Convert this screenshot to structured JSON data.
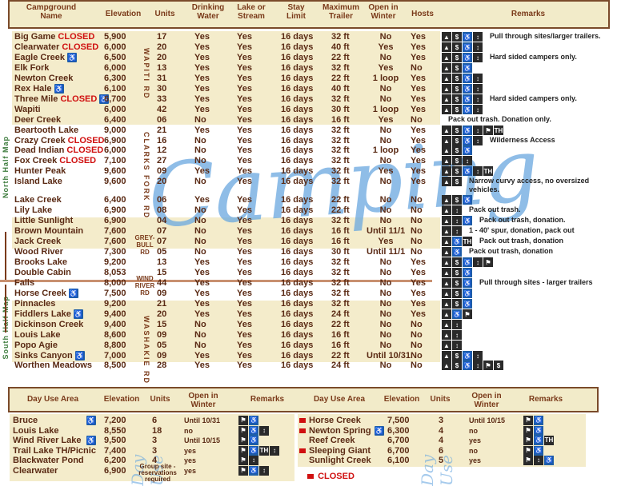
{
  "headers": {
    "name": "Campground Name",
    "elevation": "Elevation",
    "units": "Units",
    "water": "Drinking Water",
    "lake": "Lake or Stream",
    "stay": "Stay Limit",
    "trailer": "Maximum Trailer",
    "winter": "Open in Winter",
    "hosts": "Hosts",
    "remarks": "Remarks"
  },
  "watermark": "Camping",
  "side_labels": {
    "north": "North Half Map",
    "south": "South Half Map",
    "wapiti": "WAPITI RD",
    "clarks": "CLARKS FORK RD",
    "greybull": "GREY-BULL RD",
    "windriver": "WIND RIVER RD",
    "washakie": "WASHAKIE RD"
  },
  "closed_word": "CLOSED",
  "campgrounds": [
    {
      "name": "Big Game",
      "closed": "CLOSED",
      "hc": "",
      "elev": "5,900",
      "units": "17",
      "water": "Yes",
      "lake": "Yes",
      "stay": "16 days",
      "trailer": "32 ft",
      "winter": "No",
      "hosts": "Yes",
      "remark": "Pull through sites/larger trailers.",
      "icons": [
        "▲",
        "$",
        "♿",
        "↕"
      ]
    },
    {
      "name": "Clearwater",
      "closed": "CLOSED",
      "hc": "",
      "elev": "6,000",
      "units": "20",
      "water": "Yes",
      "lake": "Yes",
      "stay": "16 days",
      "trailer": "40 ft",
      "winter": "Yes",
      "hosts": "Yes",
      "remark": "",
      "icons": [
        "▲",
        "$",
        "♿",
        "↕"
      ]
    },
    {
      "name": "Eagle Creek",
      "closed": "",
      "hc": "♿",
      "elev": "6,500",
      "units": "20",
      "water": "Yes",
      "lake": "Yes",
      "stay": "16 days",
      "trailer": "22 ft",
      "winter": "No",
      "hosts": "Yes",
      "remark": "Hard sided campers only.",
      "icons": [
        "▲",
        "$",
        "♿",
        "↕"
      ]
    },
    {
      "name": "Elk Fork",
      "closed": "",
      "hc": "",
      "elev": "6,000",
      "units": "13",
      "water": "Yes",
      "lake": "Yes",
      "stay": "16 days",
      "trailer": "32 ft",
      "winter": "Yes",
      "hosts": "No",
      "remark": "",
      "icons": [
        "▲",
        "$",
        "♿"
      ]
    },
    {
      "name": "Newton Creek",
      "closed": "",
      "hc": "",
      "elev": "6,300",
      "units": "31",
      "water": "Yes",
      "lake": "Yes",
      "stay": "16 days",
      "trailer": "22 ft",
      "winter": "1 loop",
      "hosts": "Yes",
      "remark": "",
      "icons": [
        "▲",
        "$",
        "♿",
        "↕"
      ]
    },
    {
      "name": "Rex Hale",
      "closed": "",
      "hc": "♿",
      "elev": "6,100",
      "units": "30",
      "water": "Yes",
      "lake": "Yes",
      "stay": "16 days",
      "trailer": "40 ft",
      "winter": "No",
      "hosts": "Yes",
      "remark": "",
      "icons": [
        "▲",
        "$",
        "♿",
        "↕"
      ]
    },
    {
      "name": "Three Mile",
      "closed": "CLOSED",
      "hc": "♿",
      "elev": "6,700",
      "units": "33",
      "water": "Yes",
      "lake": "Yes",
      "stay": "16 days",
      "trailer": "32 ft",
      "winter": "No",
      "hosts": "Yes",
      "remark": "Hard sided campers only.",
      "icons": [
        "▲",
        "$",
        "♿",
        "↕"
      ]
    },
    {
      "name": "Wapiti",
      "closed": "",
      "hc": "",
      "elev": "6,000",
      "units": "42",
      "water": "Yes",
      "lake": "Yes",
      "stay": "16 days",
      "trailer": "30 ft",
      "winter": "1 loop",
      "hosts": "Yes",
      "remark": "",
      "icons": [
        "▲",
        "$",
        "♿",
        "↕"
      ]
    },
    {
      "name": "Deer Creek",
      "closed": "",
      "hc": "",
      "elev": "6,400",
      "units": "06",
      "water": "No",
      "lake": "Yes",
      "stay": "16 days",
      "trailer": "16 ft",
      "winter": "Yes",
      "hosts": "No",
      "remark": "Pack out trash.  Donation only.",
      "icons": []
    },
    {
      "name": "Beartooth Lake",
      "closed": "",
      "hc": "",
      "elev": "9,000",
      "units": "21",
      "water": "Yes",
      "lake": "Yes",
      "stay": "16 days",
      "trailer": "32 ft",
      "winter": "No",
      "hosts": "Yes",
      "remark": "",
      "icons": [
        "▲",
        "$",
        "♿",
        "↕",
        "⚑",
        "TH"
      ]
    },
    {
      "name": "Crazy Creek",
      "closed": "CLOSED",
      "hc": "",
      "elev": "6,900",
      "units": "16",
      "water": "No",
      "lake": "Yes",
      "stay": "16 days",
      "trailer": "32 ft",
      "winter": "No",
      "hosts": "Yes",
      "remark": "Wilderness Access",
      "icons": [
        "▲",
        "$",
        "♿",
        "↕"
      ]
    },
    {
      "name": "Dead Indian",
      "closed": "CLOSED",
      "hc": "",
      "elev": "6,000",
      "units": "12",
      "water": "No",
      "lake": "Yes",
      "stay": "16 days",
      "trailer": "32 ft",
      "winter": "1 loop",
      "hosts": "Yes",
      "remark": "",
      "icons": [
        "▲",
        "$",
        "♿"
      ]
    },
    {
      "name": "Fox Creek",
      "closed": "CLOSED",
      "hc": "",
      "elev": "7,100",
      "units": "27",
      "water": "No",
      "lake": "Yes",
      "stay": "16 days",
      "trailer": "32 ft",
      "winter": "No",
      "hosts": "Yes",
      "remark": "",
      "icons": [
        "▲",
        "$",
        "↕"
      ]
    },
    {
      "name": "Hunter Peak",
      "closed": "",
      "hc": "",
      "elev": "9,600",
      "units": "09",
      "water": "Yes",
      "lake": "Yes",
      "stay": "16 days",
      "trailer": "32 ft",
      "winter": "Yes",
      "hosts": "Yes",
      "remark": "",
      "icons": [
        "▲",
        "$",
        "♿",
        "↕",
        "TH"
      ]
    },
    {
      "name": "Island Lake",
      "closed": "",
      "hc": "",
      "elev": "9,600",
      "units": "20",
      "water": "No",
      "lake": "Yes",
      "stay": "16 days",
      "trailer": "32 ft",
      "winter": "No",
      "hosts": "Yes",
      "remark": "Narrow curvy access, no oversized  vehicles.",
      "icons": [
        "▲",
        "$"
      ]
    },
    {
      "name": "Lake Creek",
      "closed": "",
      "hc": "",
      "elev": "6,400",
      "units": "06",
      "water": "Yes",
      "lake": "Yes",
      "stay": "16 days",
      "trailer": "22 ft",
      "winter": "No",
      "hosts": "No",
      "remark": "",
      "icons": [
        "▲",
        "$",
        "♿"
      ]
    },
    {
      "name": "Lily Lake",
      "closed": "",
      "hc": "",
      "elev": "6,900",
      "units": "08",
      "water": "No",
      "lake": "Yes",
      "stay": "16 days",
      "trailer": "22 ft",
      "winter": "No",
      "hosts": "No",
      "remark": "Pack out trash.",
      "icons": [
        "▲",
        "↕"
      ]
    },
    {
      "name": "Little Sunlight",
      "closed": "",
      "hc": "",
      "elev": "6,900",
      "units": "04",
      "water": "No",
      "lake": "Yes",
      "stay": "16 days",
      "trailer": "32 ft",
      "winter": "No",
      "hosts": "No",
      "remark": "Pack out trash, donation.",
      "icons": [
        "▲",
        "↕",
        "♿"
      ]
    },
    {
      "name": "Brown Mountain",
      "closed": "",
      "hc": "",
      "elev": "7,600",
      "units": "07",
      "water": "No",
      "lake": "Yes",
      "stay": "16 days",
      "trailer": "16 ft",
      "winter": "Until 11/1",
      "hosts": "No",
      "remark": "1 - 40' spur, donation, pack out",
      "icons": [
        "▲",
        "↕"
      ]
    },
    {
      "name": "Jack Creek",
      "closed": "",
      "hc": "",
      "elev": "7,600",
      "units": "07",
      "water": "No",
      "lake": "Yes",
      "stay": "16 days",
      "trailer": "16 ft",
      "winter": "Yes",
      "hosts": "No",
      "remark": "Pack out trash, donation",
      "icons": [
        "▲",
        "♿",
        "TH"
      ]
    },
    {
      "name": "Wood River",
      "closed": "",
      "hc": "",
      "elev": "7,300",
      "units": "05",
      "water": "No",
      "lake": "Yes",
      "stay": "16 days",
      "trailer": "30 ft",
      "winter": "Until 11/1",
      "hosts": "No",
      "remark": "Pack out trash, donation",
      "icons": [
        "▲",
        "♿"
      ]
    },
    {
      "name": "Brooks Lake",
      "closed": "",
      "hc": "",
      "elev": "9,200",
      "units": "13",
      "water": "Yes",
      "lake": "Yes",
      "stay": "16 days",
      "trailer": "32 ft",
      "winter": "No",
      "hosts": "Yes",
      "remark": "",
      "icons": [
        "▲",
        "$",
        "♿",
        "↕",
        "⚑"
      ]
    },
    {
      "name": "Double Cabin",
      "closed": "",
      "hc": "",
      "elev": "8,053",
      "units": "15",
      "water": "Yes",
      "lake": "Yes",
      "stay": "16 days",
      "trailer": "32 ft",
      "winter": "No",
      "hosts": "Yes",
      "remark": "",
      "icons": [
        "▲",
        "$",
        "♿"
      ]
    },
    {
      "name": "Falls",
      "closed": "",
      "hc": "",
      "elev": "8,000",
      "units": "44",
      "water": "Yes",
      "lake": "Yes",
      "stay": "16 days",
      "trailer": "32 ft",
      "winter": "No",
      "hosts": "Yes",
      "remark": "Pull through sites - larger trailers",
      "icons": [
        "▲",
        "$",
        "♿"
      ]
    },
    {
      "name": "Horse Creek",
      "closed": "",
      "hc": "♿",
      "elev": "7,500",
      "units": "09",
      "water": "Yes",
      "lake": "Yes",
      "stay": "16 days",
      "trailer": "32 ft",
      "winter": "No",
      "hosts": "Yes",
      "remark": "",
      "icons": [
        "▲",
        "$",
        "♿"
      ]
    },
    {
      "name": "Pinnacles",
      "closed": "",
      "hc": "",
      "elev": "9,200",
      "units": "21",
      "water": "Yes",
      "lake": "Yes",
      "stay": "16 days",
      "trailer": "32 ft",
      "winter": "No",
      "hosts": "Yes",
      "remark": "",
      "icons": [
        "▲",
        "$",
        "♿"
      ]
    },
    {
      "name": "Fiddlers Lake",
      "closed": "",
      "hc": "♿",
      "elev": "9,400",
      "units": "20",
      "water": "Yes",
      "lake": "Yes",
      "stay": "16 days",
      "trailer": "24 ft",
      "winter": "No",
      "hosts": "Yes",
      "remark": "",
      "icons": [
        "▲",
        "♿",
        "⚑"
      ]
    },
    {
      "name": "Dickinson Creek",
      "closed": "",
      "hc": "",
      "elev": "9,400",
      "units": "15",
      "water": "No",
      "lake": "Yes",
      "stay": "16 days",
      "trailer": "22 ft",
      "winter": "No",
      "hosts": "No",
      "remark": "",
      "icons": [
        "▲",
        "↕"
      ]
    },
    {
      "name": "Louis Lake",
      "closed": "",
      "hc": "",
      "elev": "8,600",
      "units": "09",
      "water": "No",
      "lake": "Yes",
      "stay": "16 days",
      "trailer": "16 ft",
      "winter": "No",
      "hosts": "No",
      "remark": "",
      "icons": [
        "▲",
        "↕"
      ]
    },
    {
      "name": "Popo Agie",
      "closed": "",
      "hc": "",
      "elev": "8,800",
      "units": "05",
      "water": "No",
      "lake": "Yes",
      "stay": "16 days",
      "trailer": "16 ft",
      "winter": "No",
      "hosts": "No",
      "remark": "",
      "icons": [
        "▲",
        "↕"
      ]
    },
    {
      "name": "Sinks Canyon",
      "closed": "",
      "hc": "♿",
      "elev": "7,000",
      "units": "09",
      "water": "Yes",
      "lake": "Yes",
      "stay": "16 days",
      "trailer": "22 ft",
      "winter": "Until 10/31",
      "hosts": "No",
      "remark": "",
      "icons": [
        "▲",
        "$",
        "♿",
        "↕"
      ]
    },
    {
      "name": "Worthen Meadows",
      "closed": "",
      "hc": "",
      "elev": "8,500",
      "units": "28",
      "water": "Yes",
      "lake": "Yes",
      "stay": "16 days",
      "trailer": "24 ft",
      "winter": "No",
      "hosts": "No",
      "remark": "",
      "icons": [
        "▲",
        "$",
        "♿",
        "↕",
        "⚑",
        "$"
      ]
    }
  ],
  "dayuse_headers": {
    "area": "Day Use Area",
    "elevation": "Elevation",
    "units": "Units",
    "winter": "Open in Winter",
    "remarks": "Remarks",
    "area2": "Day Use Area",
    "elevation2": "Elevation",
    "units2": "Units",
    "winter2": "Open in Winter",
    "remarks2": "Remarks"
  },
  "dayuse_watermark": "Day Use",
  "dayuse_left": [
    {
      "name": "Bruce",
      "hc": "♿",
      "elev": "7,200",
      "units": "6",
      "winter": "Until 10/31",
      "icons": [
        "⚑",
        "♿"
      ]
    },
    {
      "name": "Louis Lake",
      "hc": "",
      "elev": "8,550",
      "units": "18",
      "winter": "no",
      "icons": [
        "⚑",
        "♿",
        "↕"
      ]
    },
    {
      "name": "Wind River Lake",
      "hc": "♿",
      "elev": "9,500",
      "units": "3",
      "winter": "Until 10/15",
      "icons": [
        "⚑",
        "♿"
      ]
    },
    {
      "name": "Trail Lake TH/Picnic",
      "hc": "",
      "elev": "7,400",
      "units": "3",
      "winter": "yes",
      "icons": [
        "⚑",
        "♿",
        "TH",
        "↕"
      ]
    },
    {
      "name": "Blackwater Pond",
      "hc": "",
      "elev": "6,200",
      "units": "4",
      "winter": "yes",
      "icons": [
        "⚑",
        "↕"
      ]
    },
    {
      "name": "Clearwater",
      "hc": "",
      "elev": "6,900",
      "units": "",
      "winter": "yes",
      "icons": [
        "⚑",
        "♿",
        "↕"
      ]
    }
  ],
  "group_site_note": "Group site - reservations required",
  "dayuse_right": [
    {
      "name": "Horse Creek",
      "hc": "",
      "closed": true,
      "elev": "7,500",
      "units": "3",
      "winter": "Until 10/15",
      "icons": [
        "⚑",
        "♿"
      ]
    },
    {
      "name": "Newton Spring",
      "hc": "♿",
      "closed": true,
      "elev": "6,300",
      "units": "4",
      "winter": "no",
      "icons": [
        "⚑",
        "♿"
      ]
    },
    {
      "name": "Reef Creek",
      "hc": "",
      "closed": false,
      "elev": "6,700",
      "units": "4",
      "winter": "yes",
      "icons": [
        "⚑",
        "♿",
        "TH"
      ]
    },
    {
      "name": "Sleeping Giant",
      "hc": "",
      "closed": true,
      "elev": "6,700",
      "units": "6",
      "winter": "no",
      "icons": [
        "⚑",
        "♿"
      ]
    },
    {
      "name": "Sunlight Creek",
      "hc": "",
      "closed": false,
      "elev": "6,100",
      "units": "5",
      "winter": "yes",
      "icons": [
        "⚑",
        "↕",
        "♿"
      ]
    }
  ],
  "legend_closed": "CLOSED",
  "colors": {
    "band": "#f4eccb",
    "header_bg": "#f2ebc9",
    "border": "#7a4a2a",
    "text": "#5a2a14",
    "closed": "#d01010",
    "watermark": "#6aa8e0"
  }
}
